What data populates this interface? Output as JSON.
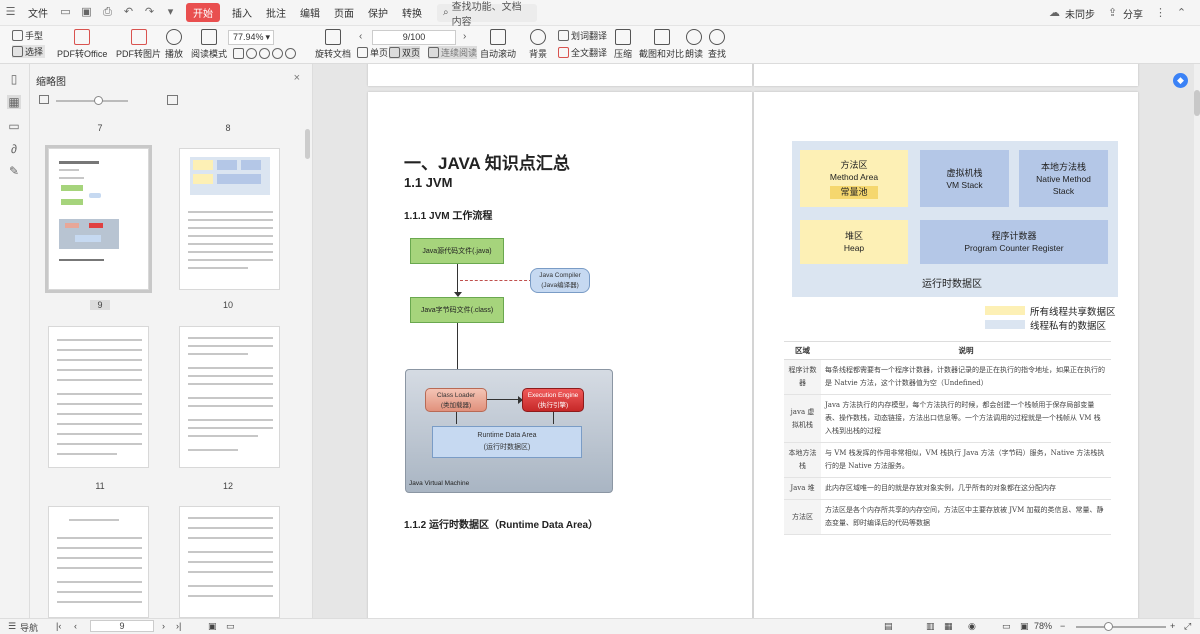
{
  "menubar": {
    "file": "文件",
    "start": "开始",
    "insert": "插入",
    "annotate": "批注",
    "edit": "编辑",
    "page": "页面",
    "protect": "保护",
    "convert": "转换",
    "search_placeholder": "查找功能、文档内容",
    "unsync": "未同步",
    "share": "分享"
  },
  "ribbon": {
    "hand": "手型",
    "select": "选择",
    "pdf_to_office": "PDF转Office",
    "pdf_to_image": "PDF转图片",
    "play": "播放",
    "read_mode": "阅读模式",
    "zoom": "77.94%",
    "page_indicator": "9/100",
    "rotate": "旋转文档",
    "single": "单页",
    "double": "双页",
    "continuous": "连续阅读",
    "auto_scroll": "自动滚动",
    "background": "背景",
    "translate_word": "划词翻译",
    "translate_full": "全文翻译",
    "compress": "压缩",
    "screenshot_compare": "截图和对比",
    "read_aloud": "朗读",
    "find": "查找"
  },
  "thumbpanel": {
    "title": "缩略图",
    "labels": [
      "7",
      "8",
      "9",
      "10",
      "11",
      "12"
    ]
  },
  "page_left": {
    "h1": "一、JAVA 知识点汇总",
    "h2": "1.1 JVM",
    "h3a": "1.1.1 JVM  工作流程",
    "h3b": "1.1.2  运行时数据区（Runtime Data Area）",
    "flow": {
      "src": "Java源代码文件(.java)",
      "compiler_en": "Java Compiler",
      "compiler_cn": "(Java编译器)",
      "bytecode": "Java字节码文件(.class)",
      "class_loader_en": "Class Loader",
      "class_loader_cn": "(类加载器)",
      "exec_engine_en": "Execution Engine",
      "exec_engine_cn": "(执行引擎)",
      "runtime_en": "Runtime  Data  Area",
      "runtime_cn": "(运行时数据区)",
      "jvm": "Java Virtual Machine"
    }
  },
  "page_right": {
    "method_area_cn": "方法区",
    "method_area_en": "Method  Area",
    "const_pool": "常量池",
    "vm_stack_cn": "虚拟机栈",
    "vm_stack_en": "VM Stack",
    "native_stack_cn": "本地方法栈",
    "native_stack_en1": "Native Method",
    "native_stack_en2": "Stack",
    "heap_cn": "堆区",
    "heap_en": "Heap",
    "pc_cn": "程序计数器",
    "pc_en": "Program Counter Register",
    "rtd_title": "运行时数据区",
    "legend_shared": "所有线程共享数据区",
    "legend_private": "线程私有的数据区",
    "table_headers": [
      "区域",
      "说明"
    ],
    "table_rows": [
      [
        "程序计数器",
        "每条线程都需要有一个程序计数器，计数器记录的是正在执行的指令地址，如果正在执行的是 Natvie  方法，这个计数器值为空（Undefined）"
      ],
      [
        "java 虚拟机栈",
        "Java  方法执行的内存模型，每个方法执行的时候，都会创建一个栈帧用于保存局部变量表、操作数栈，动态链接，方法出口信息等。一个方法调用的过程就是一个栈帧从 VM 栈入栈到出栈的过程"
      ],
      [
        "本地方法栈",
        "与  VM  栈发挥的作用非常相似，VM  栈执行  Java  方法（字节码）服务，Native  方法栈执行的是  Native  方法服务。"
      ],
      [
        "Java 堆",
        "此内存区域唯一的目的就是存放对象实例，几乎所有的对象都在这分配内存"
      ],
      [
        "方法区",
        "方法区是各个内存所共享的内存空间，方法区中主要存放被  JVM  加载的类信息、常量、静态变量、即时编译后的代码等数据"
      ]
    ]
  },
  "statusbar": {
    "nav": "导航",
    "page": "9",
    "zoom": "78%"
  },
  "colors": {
    "accent_red": "#e94f4f",
    "shared_yellow": "#fdf0b5",
    "private_blue": "#b4c7e7"
  }
}
